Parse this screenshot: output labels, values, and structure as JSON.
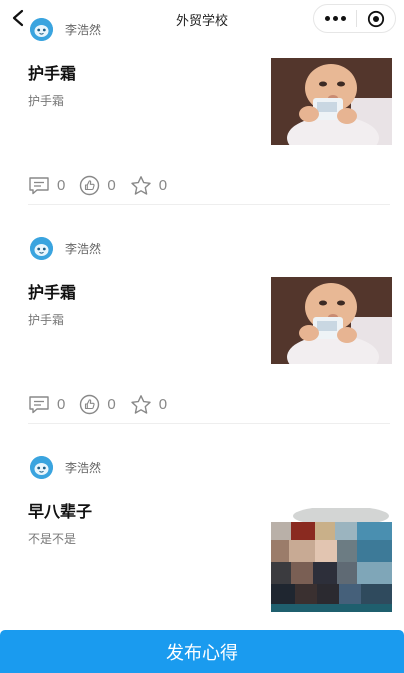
{
  "header": {
    "title": "外贸学校"
  },
  "posts": [
    {
      "author": "李浩然",
      "title": "护手霜",
      "description": "护手霜",
      "comments": "0",
      "likes": "0",
      "favorites": "0",
      "image": "baby-photo"
    },
    {
      "author": "李浩然",
      "title": "护手霜",
      "description": "护手霜",
      "comments": "0",
      "likes": "0",
      "favorites": "0",
      "image": "baby-photo"
    },
    {
      "author": "李浩然",
      "title": "早八辈子",
      "description": "不是不是",
      "image": "pixelated-photo"
    }
  ],
  "footer": {
    "publish_label": "发布心得"
  },
  "colors": {
    "accent": "#1a9bef",
    "avatar": "#3aa4df"
  }
}
